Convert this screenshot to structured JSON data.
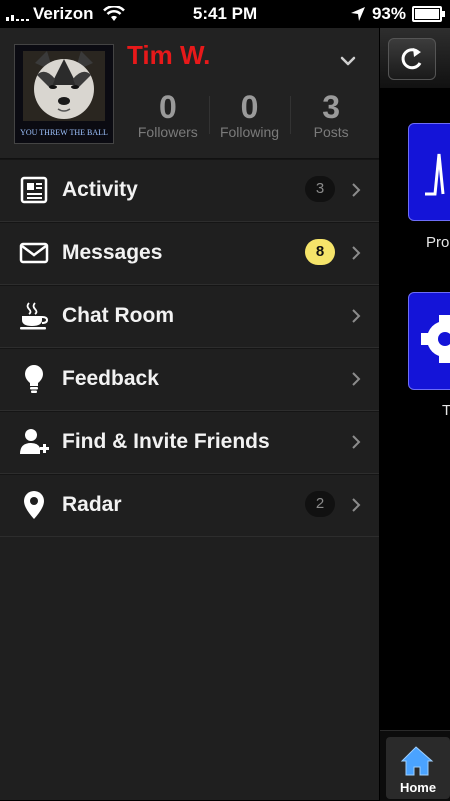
{
  "status_bar": {
    "carrier": "Verizon",
    "time": "5:41 PM",
    "battery": "93%",
    "battery_level": 0.93
  },
  "profile": {
    "name": "Tim W.",
    "avatar_caption": "YOU THREW THE BALL",
    "stats": [
      {
        "value": "0",
        "label": "Followers"
      },
      {
        "value": "0",
        "label": "Following"
      },
      {
        "value": "3",
        "label": "Posts"
      }
    ]
  },
  "menu": [
    {
      "label": "Activity",
      "icon": "newspaper-icon",
      "badge": "3",
      "badge_style": "dark"
    },
    {
      "label": "Messages",
      "icon": "envelope-icon",
      "badge": "8",
      "badge_style": "yellow"
    },
    {
      "label": "Chat Room",
      "icon": "coffee-cup-icon",
      "badge": null
    },
    {
      "label": "Feedback",
      "icon": "lightbulb-icon",
      "badge": null
    },
    {
      "label": "Find & Invite Friends",
      "icon": "add-user-icon",
      "badge": null
    },
    {
      "label": "Radar",
      "icon": "map-pin-icon",
      "badge": "2",
      "badge_style": "dark"
    }
  ],
  "content": {
    "tiles": [
      {
        "label": "Pro"
      },
      {
        "label": "T"
      }
    ],
    "tab_home": "Home"
  },
  "colors": {
    "name": "#e8191a",
    "tile": "#1414d8",
    "badge_yellow": "#f5e46a"
  }
}
